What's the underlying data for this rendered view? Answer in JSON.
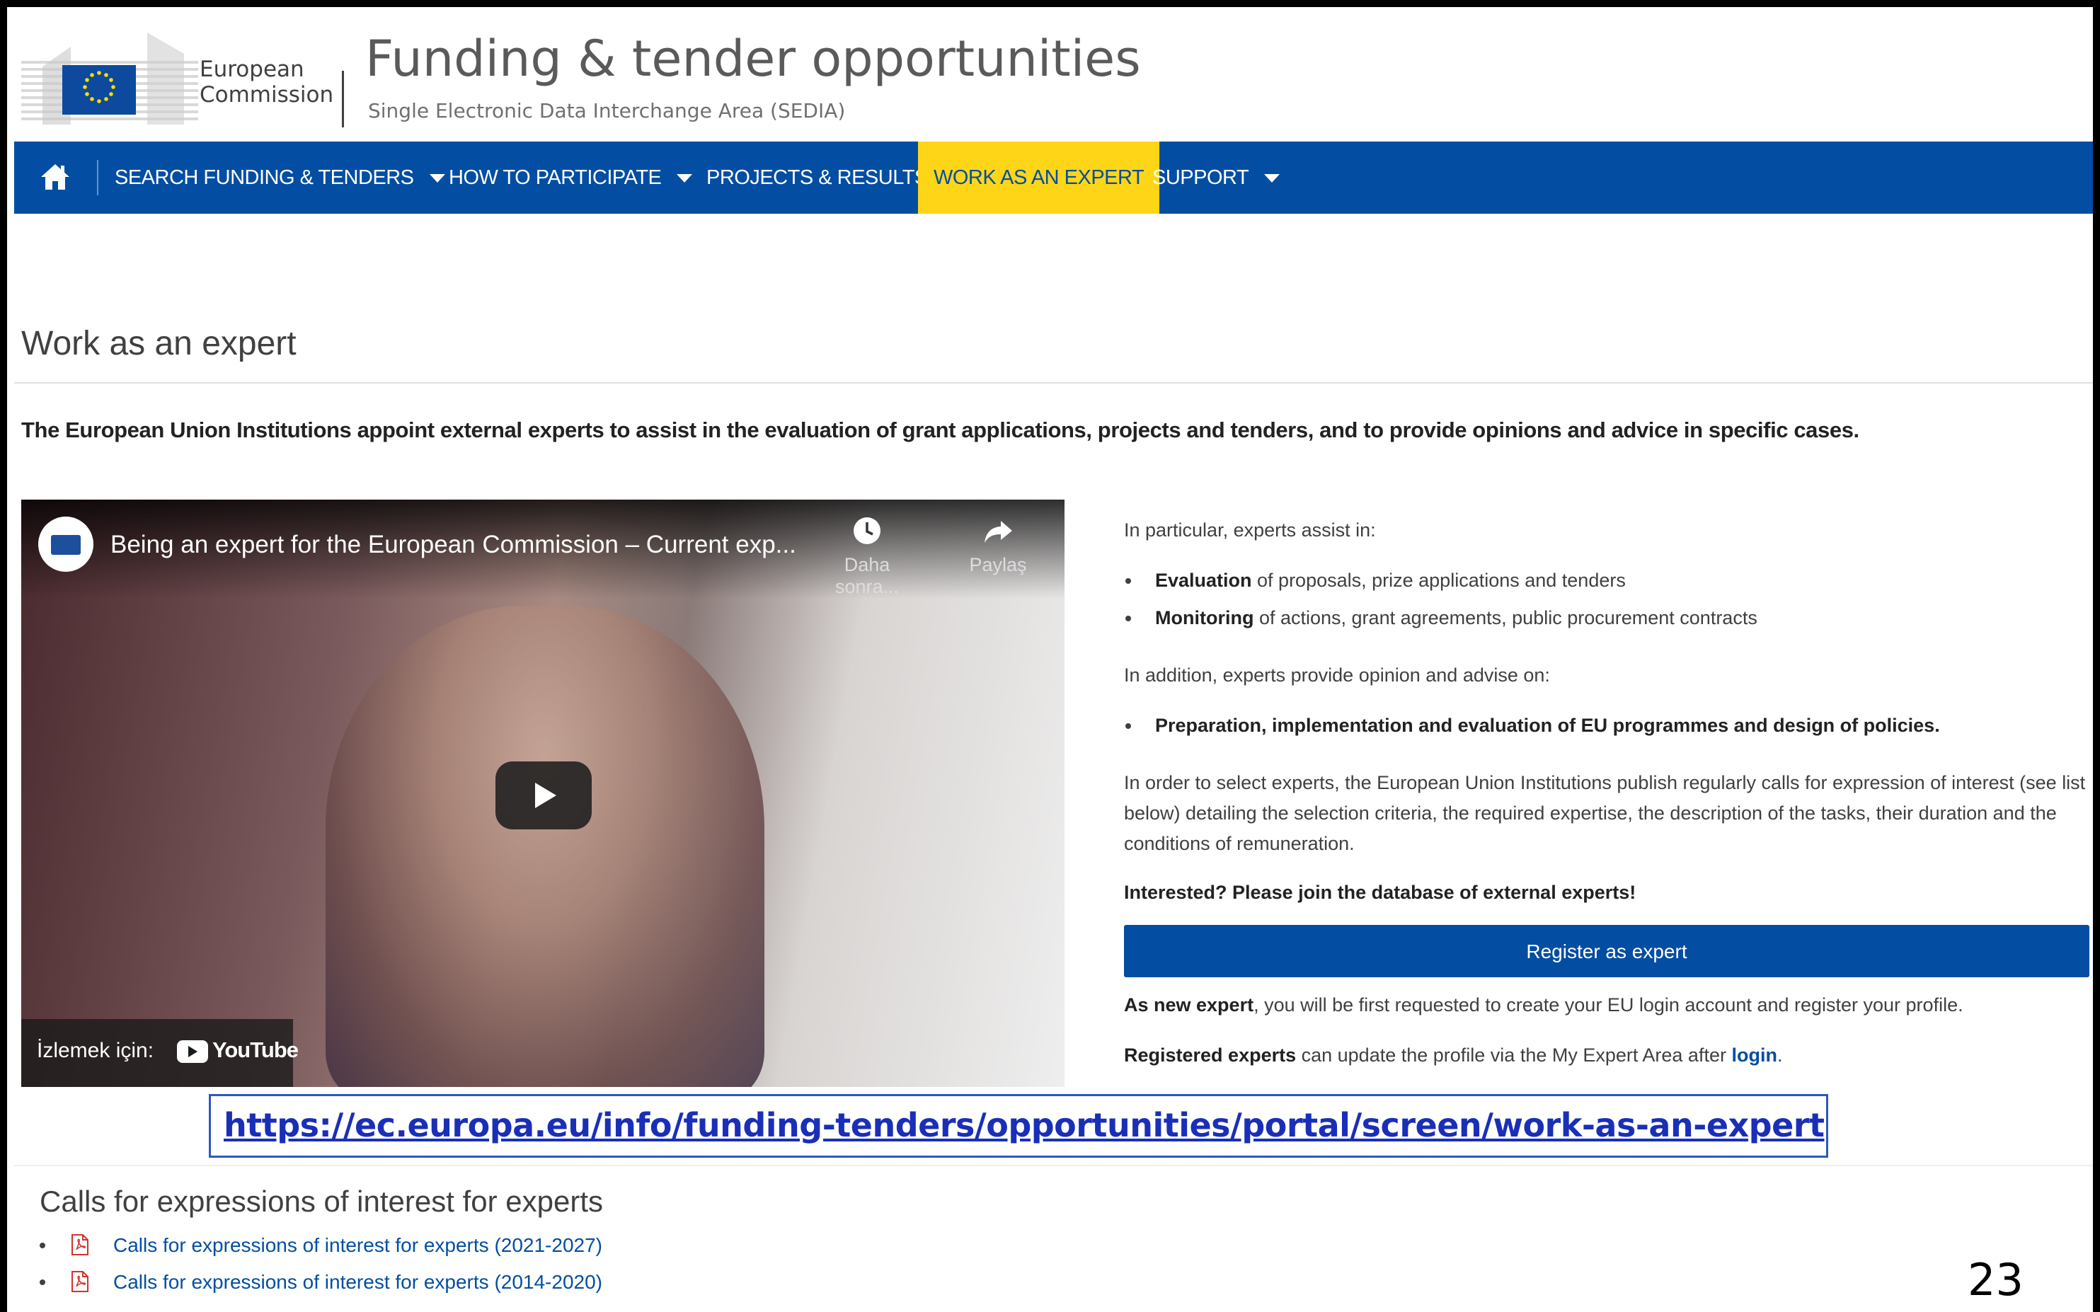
{
  "header": {
    "logo_line1": "European",
    "logo_line2": "Commission",
    "title": "Funding & tender opportunities",
    "subtitle": "Single Electronic Data Interchange Area (SEDIA)"
  },
  "nav": {
    "home_icon": "home-icon",
    "items": [
      {
        "label": "SEARCH FUNDING & TENDERS",
        "has_dropdown": true
      },
      {
        "label": "HOW TO PARTICIPATE",
        "has_dropdown": true
      },
      {
        "label": "PROJECTS & RESULTS",
        "has_dropdown": false
      },
      {
        "label": "WORK AS AN EXPERT",
        "has_dropdown": false,
        "active": true
      },
      {
        "label": "SUPPORT",
        "has_dropdown": true
      }
    ],
    "color": "#034ea2",
    "active_color": "#ffd617"
  },
  "page": {
    "title": "Work as an expert",
    "intro": "The European Union Institutions appoint external experts to assist in the evaluation of grant applications, projects and tenders, and to provide opinions and advice in specific cases."
  },
  "video": {
    "title": "Being an expert for the European Commission – Current exp...",
    "watch_later": "Daha sonra...",
    "share": "Paylaş",
    "watch_on": "İzlemek için:",
    "youtube": "YouTube"
  },
  "info": {
    "assist_intro": "In particular, experts assist in:",
    "assist_items": [
      {
        "bold": "Evaluation",
        "rest": " of proposals, prize applications and tenders"
      },
      {
        "bold": "Monitoring",
        "rest": " of actions, grant agreements, public procurement contracts"
      }
    ],
    "advise_intro": "In addition, experts provide opinion and advise on:",
    "advise_item": "Preparation, implementation and evaluation of EU programmes and design of policies.",
    "selection_text": "In order to select experts, the European Union Institutions publish regularly calls for expression of interest (see list below) detailing the selection criteria, the required expertise, the description of the tasks, their duration and the conditions of remuneration.",
    "interested": "Interested? Please join the database of external experts!",
    "register_button": "Register as expert",
    "new_expert_bold": "As new expert",
    "new_expert_rest": ", you will be first requested to create your EU login account and register your profile.",
    "registered_bold": "Registered experts",
    "registered_rest": " can update the profile via the My Expert Area after ",
    "login_link": "login",
    "registered_end": "."
  },
  "url_overlay": "https://ec.europa.eu/info/funding-tenders/opportunities/portal/screen/work-as-an-expert",
  "calls": {
    "title": "Calls for expressions of interest for experts",
    "items": [
      "Calls for expressions of interest for experts (2021-2027)",
      "Calls for expressions of interest for experts (2014-2020)"
    ]
  },
  "slide_number": "23"
}
